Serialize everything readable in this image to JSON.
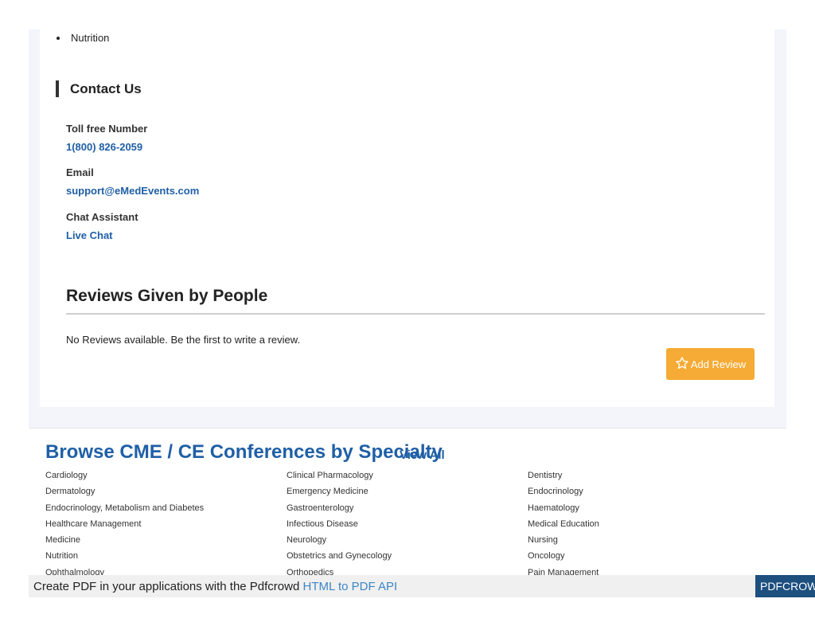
{
  "topics": {
    "last_item": "Nutrition"
  },
  "contact": {
    "title": "Contact Us",
    "toll_free_label": "Toll free Number",
    "toll_free_value": "1(800) 826-2059",
    "email_label": "Email",
    "email_value": "support@eMedEvents.com",
    "chat_label": "Chat Assistant",
    "chat_value": "Live Chat"
  },
  "reviews": {
    "title": "Reviews Given by People",
    "empty_text": "No Reviews available. Be the first to write a review.",
    "add_button_label": "Add Review",
    "add_button_icon": "star-outline-icon"
  },
  "browse": {
    "title": "Browse CME / CE Conferences by Specialty",
    "view_all_label": "View All",
    "columns": [
      [
        "Cardiology",
        "Dermatology",
        "Endocrinology, Metabolism and Diabetes",
        "Healthcare Management",
        "Medicine",
        "Nutrition",
        "Ophthalmology"
      ],
      [
        "Clinical Pharmacology",
        "Emergency Medicine",
        "Gastroenterology",
        "Infectious Disease",
        "Neurology",
        "Obstetrics and Gynecology",
        "Orthopedics"
      ],
      [
        "Dentistry",
        "Endocrinology",
        "Haematology",
        "Medical Education",
        "Nursing",
        "Oncology",
        "Pain Management"
      ]
    ]
  },
  "pdf_banner": {
    "text": "Create PDF in your applications with the Pdfcrowd ",
    "link_label": "HTML to PDF API",
    "brand": "PDFCROWD"
  },
  "colors": {
    "link_blue": "#1f5fa6",
    "button_orange": "#f5ab35",
    "banner_blue": "#1d4f7f"
  }
}
